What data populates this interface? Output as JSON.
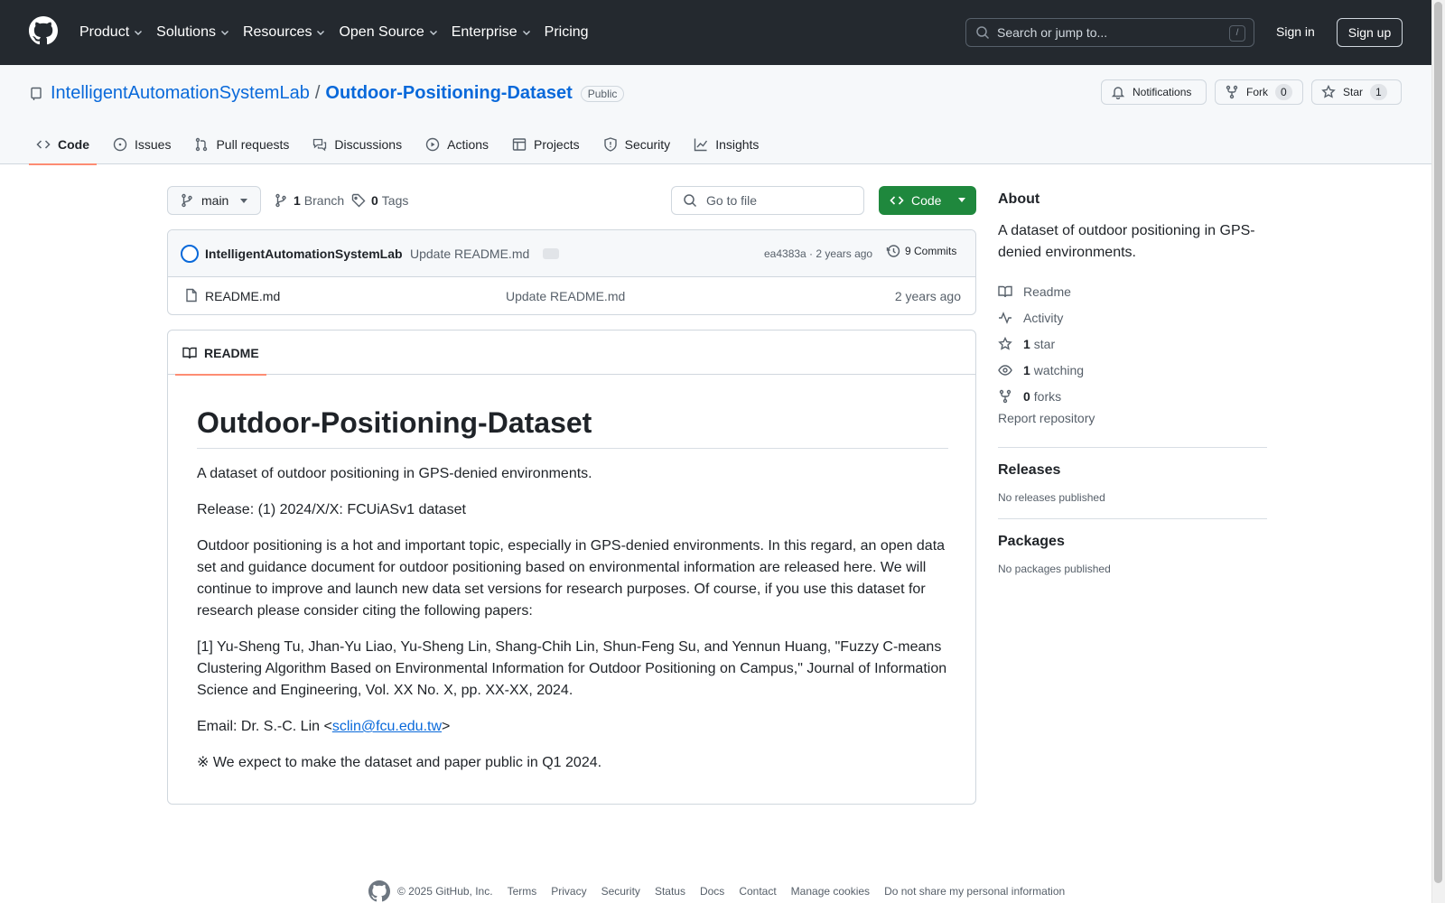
{
  "nav": {
    "items": [
      {
        "label": "Product",
        "has_menu": true
      },
      {
        "label": "Solutions",
        "has_menu": true
      },
      {
        "label": "Resources",
        "has_menu": true
      },
      {
        "label": "Open Source",
        "has_menu": true
      },
      {
        "label": "Enterprise",
        "has_menu": true
      },
      {
        "label": "Pricing",
        "has_menu": false
      }
    ],
    "search_placeholder": "Search or jump to...",
    "search_shortcut": "/",
    "sign_in": "Sign in",
    "sign_up": "Sign up"
  },
  "repo": {
    "owner": "IntelligentAutomationSystemLab",
    "separator": "/",
    "name": "Outdoor-Positioning-Dataset",
    "visibility": "Public",
    "notifications_label": "Notifications",
    "fork_label": "Fork",
    "fork_count": "0",
    "star_label": "Star",
    "star_count": "1"
  },
  "tabs": [
    {
      "label": "Code",
      "icon": "code-icon",
      "active": true
    },
    {
      "label": "Issues",
      "icon": "issue-icon",
      "active": false
    },
    {
      "label": "Pull requests",
      "icon": "pull-request-icon",
      "active": false
    },
    {
      "label": "Discussions",
      "icon": "discussion-icon",
      "active": false
    },
    {
      "label": "Actions",
      "icon": "play-icon",
      "active": false
    },
    {
      "label": "Projects",
      "icon": "table-icon",
      "active": false
    },
    {
      "label": "Security",
      "icon": "shield-icon",
      "active": false
    },
    {
      "label": "Insights",
      "icon": "graph-icon",
      "active": false
    }
  ],
  "toolbar": {
    "branch": "main",
    "branch_count": "1",
    "branch_label": "Branch",
    "tag_count": "0",
    "tag_label": "Tags",
    "goto_placeholder": "Go to file",
    "code_button": "Code"
  },
  "commit": {
    "author": "IntelligentAutomationSystemLab",
    "message": "Update README.md",
    "hash": "ea4383a",
    "age": "2 years ago",
    "hash_age": "ea4383a · 2 years ago",
    "commits": "9 Commits"
  },
  "files": [
    {
      "name": "README.md",
      "message": "Update README.md",
      "date": "2 years ago"
    }
  ],
  "readme": {
    "tab_label": "README",
    "title": "Outdoor-Positioning-Dataset",
    "p1": "A dataset of outdoor positioning in GPS-denied environments.",
    "p2": "Release: (1) 2024/X/X: FCUiASv1 dataset",
    "p3": "Outdoor positioning is a hot and important topic, especially in GPS-denied environments. In this regard, an open data set and guidance document for outdoor positioning based on environmental information are released here. We will continue to improve and launch new data set versions for research purposes. Of course, if you use this dataset for research please consider citing the following papers:",
    "p4": "[1] Yu-Sheng Tu, Jhan-Yu Liao, Yu-Sheng Lin, Shang-Chih Lin, Shun-Feng Su, and Yennun Huang, \"Fuzzy C-means Clustering Algorithm Based on Environmental Information for Outdoor Positioning on Campus,\" Journal of Information Science and Engineering, Vol. XX No. X, pp. XX-XX, 2024.",
    "email_prefix": "Email: Dr. S.-C. Lin <",
    "email": "sclin@fcu.edu.tw",
    "email_suffix": ">",
    "p6": "※ We expect to make the dataset and paper public in Q1 2024."
  },
  "about": {
    "heading": "About",
    "description": "A dataset of outdoor positioning in GPS-denied environments.",
    "readme": "Readme",
    "activity": "Activity",
    "stars_count": "1",
    "stars_label": "star",
    "watching_count": "1",
    "watching_label": "watching",
    "forks_count": "0",
    "forks_label": "forks",
    "report": "Report repository",
    "releases_heading": "Releases",
    "releases_text": "No releases published",
    "packages_heading": "Packages",
    "packages_text": "No packages published"
  },
  "footer": {
    "copyright": "© 2025 GitHub, Inc.",
    "links": [
      "Terms",
      "Privacy",
      "Security",
      "Status",
      "Docs",
      "Contact",
      "Manage cookies",
      "Do not share my personal information"
    ]
  },
  "colors": {
    "header_bg": "#24292f",
    "link": "#0969da",
    "primary_button": "#1f883d",
    "tab_underline": "#fd8c73"
  }
}
